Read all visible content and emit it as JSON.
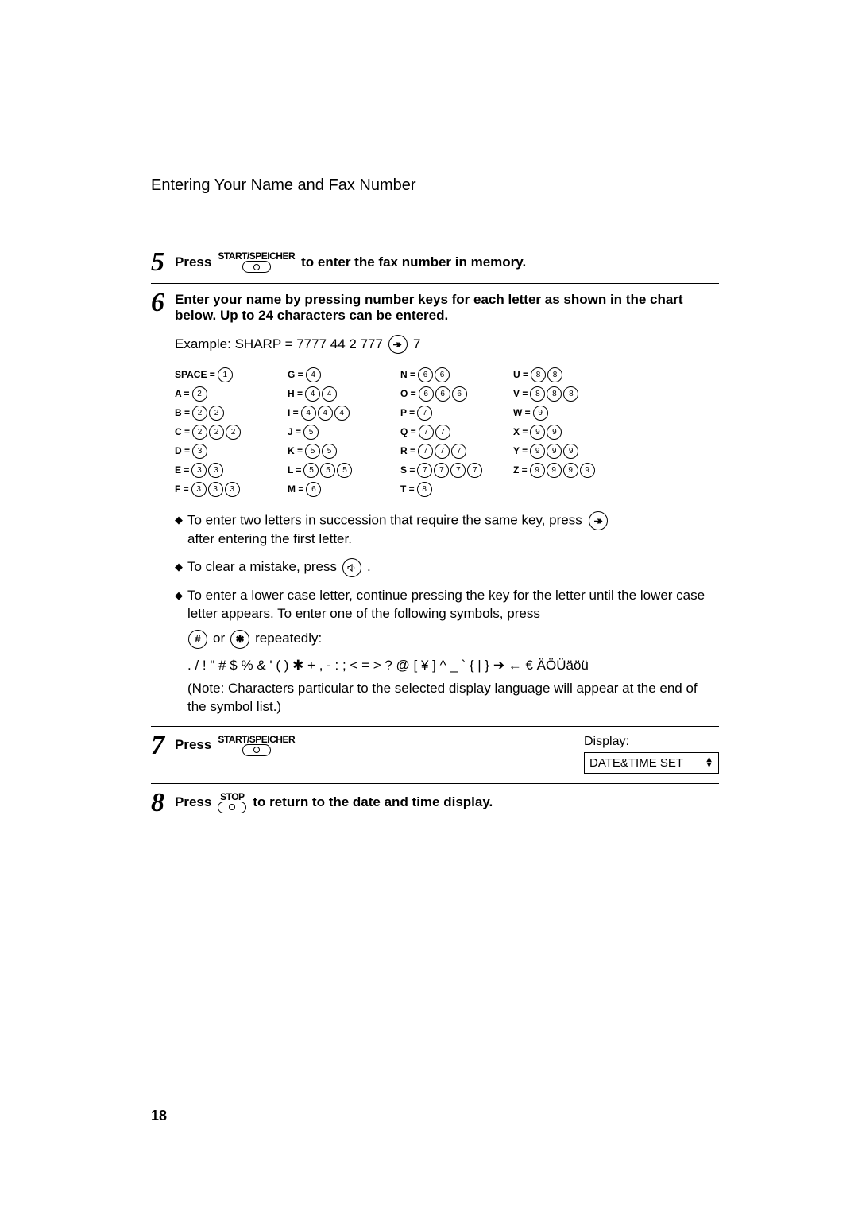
{
  "header": {
    "title": "Entering Your Name and Fax Number"
  },
  "footer": {
    "page_number": "18"
  },
  "labels": {
    "press": "Press",
    "or": "or",
    "repeatedly": "repeatedly:"
  },
  "buttons": {
    "start_speicher": "START/SPEICHER",
    "stop": "STOP"
  },
  "steps": {
    "s5": {
      "num": "5",
      "text_before": "Press",
      "text_after": "to enter the fax number in memory."
    },
    "s6": {
      "num": "6",
      "head": "Enter your name by pressing number keys for each letter as shown in the chart below. Up to 24 characters can be entered.",
      "example_prefix": "Example: SHARP = 7777  44  2  777",
      "example_suffix": "7",
      "chart": [
        [
          {
            "label": "SPACE =",
            "keys": [
              "1"
            ]
          },
          {
            "label": "A =",
            "keys": [
              "2"
            ]
          },
          {
            "label": "B =",
            "keys": [
              "2",
              "2"
            ]
          },
          {
            "label": "C =",
            "keys": [
              "2",
              "2",
              "2"
            ]
          },
          {
            "label": "D =",
            "keys": [
              "3"
            ]
          },
          {
            "label": "E =",
            "keys": [
              "3",
              "3"
            ]
          },
          {
            "label": "F =",
            "keys": [
              "3",
              "3",
              "3"
            ]
          }
        ],
        [
          {
            "label": "G =",
            "keys": [
              "4"
            ]
          },
          {
            "label": "H =",
            "keys": [
              "4",
              "4"
            ]
          },
          {
            "label": "I =",
            "keys": [
              "4",
              "4",
              "4"
            ]
          },
          {
            "label": "J =",
            "keys": [
              "5"
            ]
          },
          {
            "label": "K =",
            "keys": [
              "5",
              "5"
            ]
          },
          {
            "label": "L =",
            "keys": [
              "5",
              "5",
              "5"
            ]
          },
          {
            "label": "M =",
            "keys": [
              "6"
            ]
          }
        ],
        [
          {
            "label": "N =",
            "keys": [
              "6",
              "6"
            ]
          },
          {
            "label": "O =",
            "keys": [
              "6",
              "6",
              "6"
            ]
          },
          {
            "label": "P =",
            "keys": [
              "7"
            ]
          },
          {
            "label": "Q =",
            "keys": [
              "7",
              "7"
            ]
          },
          {
            "label": "R =",
            "keys": [
              "7",
              "7",
              "7"
            ]
          },
          {
            "label": "S =",
            "keys": [
              "7",
              "7",
              "7",
              "7"
            ]
          },
          {
            "label": "T =",
            "keys": [
              "8"
            ]
          }
        ],
        [
          {
            "label": "U =",
            "keys": [
              "8",
              "8"
            ]
          },
          {
            "label": "V =",
            "keys": [
              "8",
              "8",
              "8"
            ]
          },
          {
            "label": "W =",
            "keys": [
              "9"
            ]
          },
          {
            "label": "X =",
            "keys": [
              "9",
              "9"
            ]
          },
          {
            "label": "Y =",
            "keys": [
              "9",
              "9",
              "9"
            ]
          },
          {
            "label": "Z =",
            "keys": [
              "9",
              "9",
              "9",
              "9"
            ]
          }
        ]
      ],
      "bullet1a": "To enter two letters in succession that require the same key, press",
      "bullet1b": "after entering the first letter.",
      "bullet2": "To clear a mistake, press",
      "bullet2_end": ".",
      "bullet3": "To enter a lower case letter, continue pressing the key for the letter until the lower case letter appears. To enter one of the following symbols, press",
      "symbols": ". / ! \" # $ % & ' ( ) ✱ + , - : ; < = > ? @ [ ¥ ] ^ _ ` { | } ➔ ← € ÄÖÜäöü",
      "note": "(Note: Characters particular to the selected display language will appear at the end of the symbol list.)"
    },
    "s7": {
      "num": "7",
      "text_before": "Press",
      "display_label": "Display:",
      "display_value": "DATE&TIME SET"
    },
    "s8": {
      "num": "8",
      "text_before": "Press",
      "text_after": "to return to the date and time display."
    }
  }
}
